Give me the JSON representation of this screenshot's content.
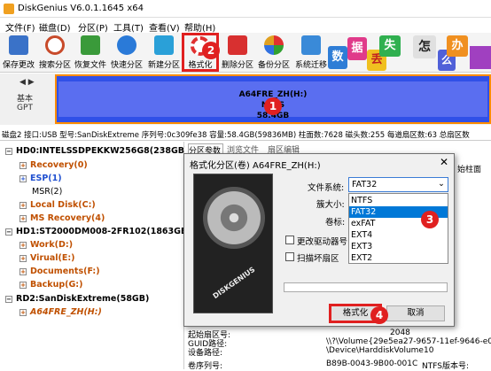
{
  "window": {
    "title": "DiskGenius V6.0.1.1645 x64"
  },
  "menu": [
    {
      "label": "文件(F)"
    },
    {
      "label": "磁盘(D)"
    },
    {
      "label": "分区(P)"
    },
    {
      "label": "工具(T)"
    },
    {
      "label": "查看(V)"
    },
    {
      "label": "帮助(H)"
    }
  ],
  "toolbar": [
    {
      "label": "保存更改",
      "icon": "save-icon",
      "color": "#3a72c8"
    },
    {
      "label": "搜索分区",
      "icon": "search-partition-icon",
      "color": "#c84a2a"
    },
    {
      "label": "恢复文件",
      "icon": "recover-file-icon",
      "color": "#3a9a3a"
    },
    {
      "label": "快速分区",
      "icon": "quick-partition-icon",
      "color": "#2a7ad8"
    },
    {
      "label": "新建分区",
      "icon": "new-partition-icon",
      "color": "#2aa0d8"
    },
    {
      "label": "格式化",
      "icon": "format-icon",
      "color": "#e03030"
    },
    {
      "label": "删除分区",
      "icon": "delete-partition-icon",
      "color": "#d83030"
    },
    {
      "label": "备份分区",
      "icon": "backup-partition-icon",
      "color": "#e0a020"
    },
    {
      "label": "系统迁移",
      "icon": "system-migrate-icon",
      "color": "#3a8ad8"
    }
  ],
  "promo": [
    "数",
    "据",
    "丢",
    "失",
    "怎",
    "么",
    "办"
  ],
  "disk_graphic": {
    "scheme_line1": "基本",
    "scheme_line2": "GPT",
    "partition_name": "A64FRE_ZH(H:)",
    "partition_fs": "NTFS",
    "partition_size": "58.4GB"
  },
  "disk_info": "磁盘2 接口:USB  型号:SanDiskExtreme  序列号:0c309fe38  容量:58.4GB(59836MB)  柱面数:7628  磁头数:255  每道扇区数:63  总扇区数",
  "tree": [
    {
      "label": "HD0:INTELSSDPEKKW256G8(238GB)",
      "level": 0,
      "style": "bold"
    },
    {
      "label": "Recovery(0)",
      "level": 1,
      "style": "orange"
    },
    {
      "label": "ESP(1)",
      "level": 1,
      "style": "blue"
    },
    {
      "label": "MSR(2)",
      "level": 1,
      "style": "normal"
    },
    {
      "label": "Local Disk(C:)",
      "level": 1,
      "style": "orange"
    },
    {
      "label": "MS Recovery(4)",
      "level": 1,
      "style": "orange"
    },
    {
      "label": "HD1:ST2000DM008-2FR102(1863GB)",
      "level": 0,
      "style": "bold"
    },
    {
      "label": "Work(D:)",
      "level": 1,
      "style": "orange"
    },
    {
      "label": "Virual(E:)",
      "level": 1,
      "style": "orange"
    },
    {
      "label": "Documents(F:)",
      "level": 1,
      "style": "orange"
    },
    {
      "label": "Backup(G:)",
      "level": 1,
      "style": "orange"
    },
    {
      "label": "RD2:SanDiskExtreme(58GB)",
      "level": 0,
      "style": "bold"
    },
    {
      "label": "A64FRE_ZH(H:)",
      "level": 1,
      "style": "orange-italic"
    }
  ],
  "right_tabs": [
    "分区参数",
    "浏览文件",
    "扇区编辑"
  ],
  "right_fragment": "始柱面",
  "right_info": [
    {
      "label": "起始扇区号:",
      "value": ""
    },
    {
      "label": "GUID路径:",
      "value": "\\\\?\\Volume{29e5ea27-9657-11ef-9646-e0d"
    },
    {
      "label": "设备路径:",
      "value": "\\Device\\HarddiskVolume10"
    },
    {
      "label": "卷序列号:",
      "value": "B89B-0043-9B00-001C"
    },
    {
      "label": "NTFS版本号:",
      "value": ""
    }
  ],
  "right_num": "2048",
  "dialog": {
    "title": "格式化分区(卷) A64FRE_ZH(H:)",
    "fs_label": "文件系统:",
    "cluster_label": "簇大小:",
    "vol_label": "卷标:",
    "fs_value": "FAT32",
    "fs_options": [
      "NTFS",
      "FAT32",
      "exFAT",
      "EXT4",
      "EXT3",
      "EXT2"
    ],
    "selected_index": 1,
    "chk_change_drive": "更改驱动器号",
    "chk_scan": "扫描坏扇区",
    "format_button": "格式化",
    "cancel_button": "取消"
  },
  "badges": [
    "1",
    "2",
    "3",
    "4"
  ],
  "colors": {
    "accent": "#e02020",
    "selection": "#0078d7",
    "partition": "#3050e8"
  }
}
